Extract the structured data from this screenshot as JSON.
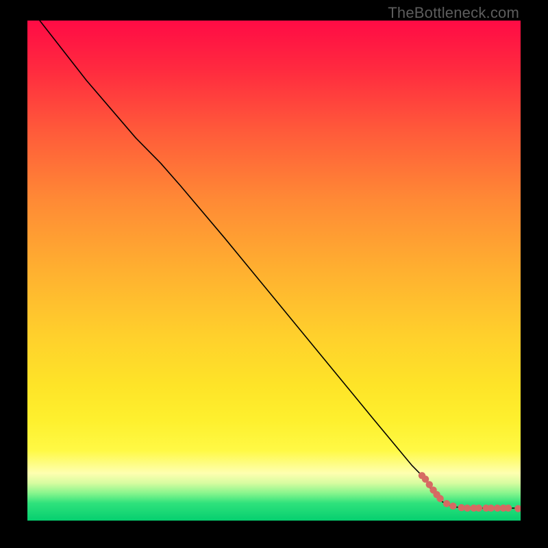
{
  "watermark": "TheBottleneck.com",
  "colors": {
    "point": "#d66a63",
    "curve": "#000000",
    "frame": "#000000"
  },
  "chart_data": {
    "type": "line",
    "title": "",
    "xlabel": "",
    "ylabel": "",
    "xlim": [
      0,
      100
    ],
    "ylim": [
      0,
      100
    ],
    "grid": false,
    "legend": false,
    "curve": [
      {
        "x": 2.5,
        "y": 100.0
      },
      {
        "x": 12.0,
        "y": 88.0
      },
      {
        "x": 22.0,
        "y": 76.5
      },
      {
        "x": 27.0,
        "y": 71.5
      },
      {
        "x": 31.0,
        "y": 67.0
      },
      {
        "x": 40.0,
        "y": 56.5
      },
      {
        "x": 50.0,
        "y": 44.5
      },
      {
        "x": 60.0,
        "y": 32.5
      },
      {
        "x": 70.0,
        "y": 20.5
      },
      {
        "x": 78.0,
        "y": 11.0
      },
      {
        "x": 80.5,
        "y": 8.5
      },
      {
        "x": 82.0,
        "y": 6.0
      },
      {
        "x": 83.5,
        "y": 4.2
      },
      {
        "x": 85.0,
        "y": 3.2
      },
      {
        "x": 87.0,
        "y": 2.7
      },
      {
        "x": 90.0,
        "y": 2.5
      },
      {
        "x": 94.0,
        "y": 2.5
      },
      {
        "x": 97.0,
        "y": 2.5
      },
      {
        "x": 100.0,
        "y": 2.5
      }
    ],
    "series": [
      {
        "name": "data-points",
        "points": [
          {
            "x": 80.0,
            "y": 9.0
          },
          {
            "x": 80.7,
            "y": 8.3
          },
          {
            "x": 81.5,
            "y": 7.2
          },
          {
            "x": 82.3,
            "y": 6.1
          },
          {
            "x": 83.0,
            "y": 5.2
          },
          {
            "x": 83.7,
            "y": 4.4
          },
          {
            "x": 85.0,
            "y": 3.4
          },
          {
            "x": 86.3,
            "y": 2.9
          },
          {
            "x": 88.0,
            "y": 2.6
          },
          {
            "x": 89.2,
            "y": 2.5
          },
          {
            "x": 90.5,
            "y": 2.5
          },
          {
            "x": 91.5,
            "y": 2.5
          },
          {
            "x": 93.0,
            "y": 2.5
          },
          {
            "x": 94.0,
            "y": 2.5
          },
          {
            "x": 95.3,
            "y": 2.5
          },
          {
            "x": 96.5,
            "y": 2.5
          },
          {
            "x": 97.5,
            "y": 2.5
          },
          {
            "x": 99.5,
            "y": 2.4
          }
        ]
      }
    ]
  }
}
